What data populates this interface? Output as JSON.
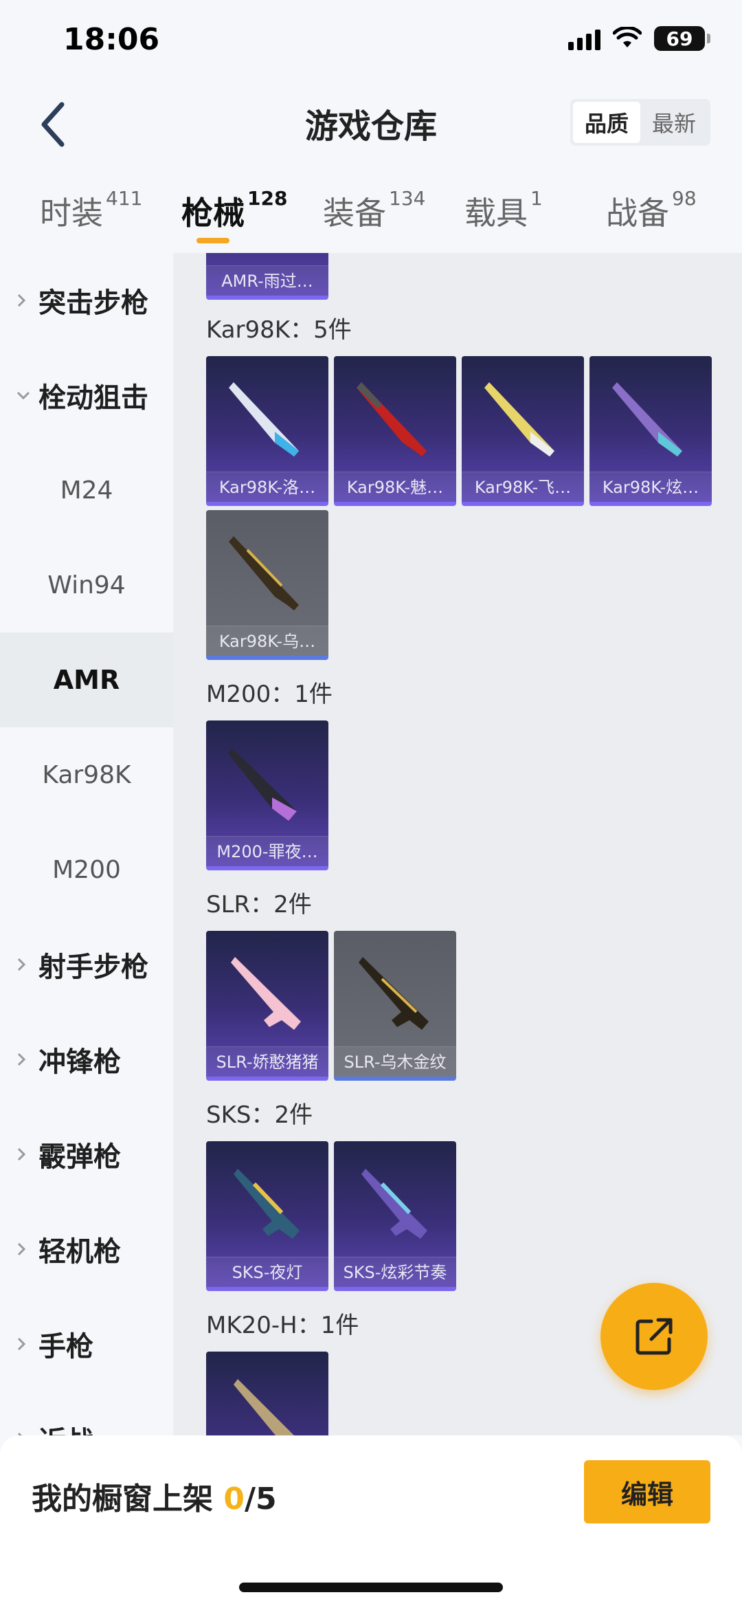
{
  "status_bar": {
    "time": "18:06",
    "battery": "69"
  },
  "header": {
    "title": "游戏仓库",
    "sort": [
      "品质",
      "最新"
    ]
  },
  "tabs": [
    {
      "label": "时装",
      "count": "411"
    },
    {
      "label": "枪械",
      "count": "128"
    },
    {
      "label": "装备",
      "count": "134"
    },
    {
      "label": "载具",
      "count": "1"
    },
    {
      "label": "战备",
      "count": "98"
    }
  ],
  "sidebar": {
    "items": [
      {
        "label": "突击步枪",
        "type": "cat"
      },
      {
        "label": "栓动狙击",
        "type": "cat"
      },
      {
        "label": "M24",
        "type": "sub"
      },
      {
        "label": "Win94",
        "type": "sub"
      },
      {
        "label": "AMR",
        "type": "sub"
      },
      {
        "label": "Kar98K",
        "type": "sub"
      },
      {
        "label": "M200",
        "type": "sub"
      },
      {
        "label": "射手步枪",
        "type": "cat"
      },
      {
        "label": "冲锋枪",
        "type": "cat"
      },
      {
        "label": "霰弹枪",
        "type": "cat"
      },
      {
        "label": "轻机枪",
        "type": "cat"
      },
      {
        "label": "手枪",
        "type": "cat"
      },
      {
        "label": "近战",
        "type": "cat"
      }
    ]
  },
  "groups": [
    {
      "label": "Kar98K：5件",
      "items": [
        "Kar98K-洛…",
        "Kar98K-魅…",
        "Kar98K-飞…",
        "Kar98K-炫…",
        "Kar98K-乌…"
      ]
    },
    {
      "label": "M200：1件",
      "items": [
        "M200-罪夜…"
      ]
    },
    {
      "label": "SLR：2件",
      "items": [
        "SLR-娇憨猪猪",
        "SLR-乌木金纹"
      ]
    },
    {
      "label": "SKS：2件",
      "items": [
        "SKS-夜灯",
        "SKS-炫彩节奏"
      ]
    },
    {
      "label": "MK20-H：1件",
      "items": []
    }
  ],
  "top_partial_card": "AMR-雨过…",
  "bottom": {
    "shelf_label": "我的橱窗上架 ",
    "current": "0",
    "total": "/5",
    "edit": "编辑"
  },
  "colors": {
    "accent": "#f7ad16",
    "card_purple": "#3a2f78",
    "card_gray": "#6b6e77"
  }
}
